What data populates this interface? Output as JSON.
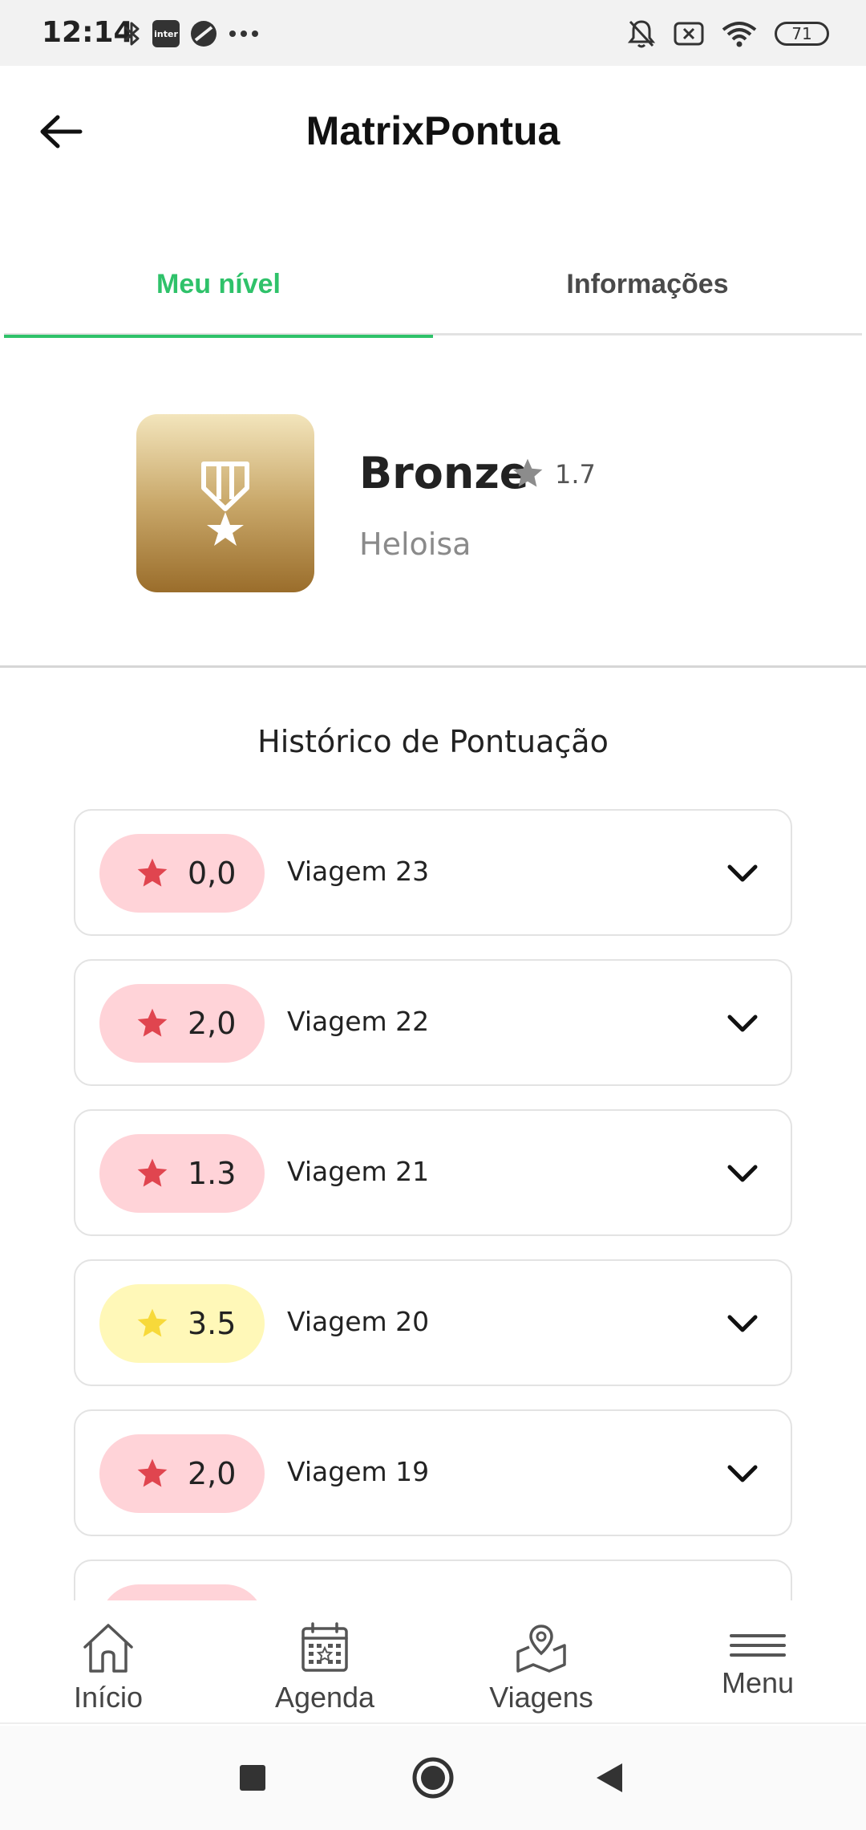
{
  "status_bar": {
    "time": "12:14",
    "inter_badge": "inter",
    "battery": "71",
    "left_icons": [
      "bluetooth-icon",
      "inter-app-icon",
      "circle-slash-icon",
      "more-dots-icon"
    ],
    "right_icons": [
      "bell-off-icon",
      "sim-x-icon",
      "wifi-icon",
      "battery-icon"
    ]
  },
  "header": {
    "title": "MatrixPontua",
    "back_icon": "arrow-left-icon"
  },
  "tabs": [
    {
      "label": "Meu nível",
      "active": true
    },
    {
      "label": "Informações",
      "active": false
    }
  ],
  "level": {
    "name": "Bronze",
    "score": "1.7",
    "user": "Heloisa",
    "medal_icon": "medal-icon"
  },
  "history": {
    "title": "Histórico de Pontuação",
    "items": [
      {
        "score": "0,0",
        "label": "Viagem 23",
        "tone": "low"
      },
      {
        "score": "2,0",
        "label": "Viagem 22",
        "tone": "low"
      },
      {
        "score": "1.3",
        "label": "Viagem 21",
        "tone": "low"
      },
      {
        "score": "3.5",
        "label": "Viagem 20",
        "tone": "mid"
      },
      {
        "score": "2,0",
        "label": "Viagem 19",
        "tone": "low"
      }
    ]
  },
  "bottom_nav": [
    {
      "label": "Início",
      "icon": "home-icon"
    },
    {
      "label": "Agenda",
      "icon": "calendar-icon"
    },
    {
      "label": "Viagens",
      "icon": "map-pin-icon"
    },
    {
      "label": "Menu",
      "icon": "menu-icon"
    }
  ],
  "colors": {
    "accent_green": "#2fc26a",
    "pill_low": "#ffd3d8",
    "pill_mid": "#fff8b8",
    "star_red": "#e0454f",
    "star_yellow": "#f7d93a",
    "medal_top": "#f3e5bc",
    "medal_bottom": "#9a6d2b"
  }
}
